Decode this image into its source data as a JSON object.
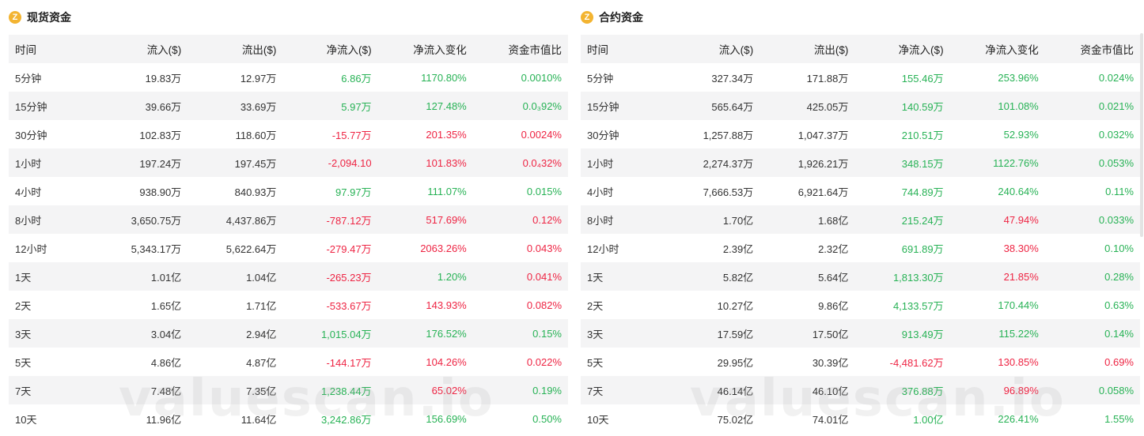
{
  "colors": {
    "positive": "#27b255",
    "negative": "#ee2443",
    "accent": "#f3b431"
  },
  "watermark": "valuescan.io",
  "spot": {
    "title": "现货资金",
    "icon": "coin-icon",
    "columns": [
      "时间",
      "流入($)",
      "流出($)",
      "净流入($)",
      "净流入变化",
      "资金市值比"
    ],
    "rows": [
      {
        "time": "5分钟",
        "inflow": "19.83万",
        "outflow": "12.97万",
        "net": "6.86万",
        "net_s": "pos",
        "change": "1170.80%",
        "change_s": "pos",
        "ratio": "0.0010%",
        "ratio_s": "pos"
      },
      {
        "time": "15分钟",
        "inflow": "39.66万",
        "outflow": "33.69万",
        "net": "5.97万",
        "net_s": "pos",
        "change": "127.48%",
        "change_s": "pos",
        "ratio": "0.0₃92%",
        "ratio_s": "pos"
      },
      {
        "time": "30分钟",
        "inflow": "102.83万",
        "outflow": "118.60万",
        "net": "-15.77万",
        "net_s": "neg",
        "change": "201.35%",
        "change_s": "neg",
        "ratio": "0.0024%",
        "ratio_s": "neg"
      },
      {
        "time": "1小时",
        "inflow": "197.24万",
        "outflow": "197.45万",
        "net": "-2,094.10",
        "net_s": "neg",
        "change": "101.83%",
        "change_s": "neg",
        "ratio": "0.0₄32%",
        "ratio_s": "neg"
      },
      {
        "time": "4小时",
        "inflow": "938.90万",
        "outflow": "840.93万",
        "net": "97.97万",
        "net_s": "pos",
        "change": "111.07%",
        "change_s": "pos",
        "ratio": "0.015%",
        "ratio_s": "pos"
      },
      {
        "time": "8小时",
        "inflow": "3,650.75万",
        "outflow": "4,437.86万",
        "net": "-787.12万",
        "net_s": "neg",
        "change": "517.69%",
        "change_s": "neg",
        "ratio": "0.12%",
        "ratio_s": "neg"
      },
      {
        "time": "12小时",
        "inflow": "5,343.17万",
        "outflow": "5,622.64万",
        "net": "-279.47万",
        "net_s": "neg",
        "change": "2063.26%",
        "change_s": "neg",
        "ratio": "0.043%",
        "ratio_s": "neg"
      },
      {
        "time": "1天",
        "inflow": "1.01亿",
        "outflow": "1.04亿",
        "net": "-265.23万",
        "net_s": "neg",
        "change": "1.20%",
        "change_s": "pos",
        "ratio": "0.041%",
        "ratio_s": "neg"
      },
      {
        "time": "2天",
        "inflow": "1.65亿",
        "outflow": "1.71亿",
        "net": "-533.67万",
        "net_s": "neg",
        "change": "143.93%",
        "change_s": "neg",
        "ratio": "0.082%",
        "ratio_s": "neg"
      },
      {
        "time": "3天",
        "inflow": "3.04亿",
        "outflow": "2.94亿",
        "net": "1,015.04万",
        "net_s": "pos",
        "change": "176.52%",
        "change_s": "pos",
        "ratio": "0.15%",
        "ratio_s": "pos"
      },
      {
        "time": "5天",
        "inflow": "4.86亿",
        "outflow": "4.87亿",
        "net": "-144.17万",
        "net_s": "neg",
        "change": "104.26%",
        "change_s": "neg",
        "ratio": "0.022%",
        "ratio_s": "neg"
      },
      {
        "time": "7天",
        "inflow": "7.48亿",
        "outflow": "7.35亿",
        "net": "1,238.44万",
        "net_s": "pos",
        "change": "65.02%",
        "change_s": "neg",
        "ratio": "0.19%",
        "ratio_s": "pos"
      },
      {
        "time": "10天",
        "inflow": "11.96亿",
        "outflow": "11.64亿",
        "net": "3,242.86万",
        "net_s": "pos",
        "change": "156.69%",
        "change_s": "pos",
        "ratio": "0.50%",
        "ratio_s": "pos"
      }
    ]
  },
  "futures": {
    "title": "合约资金",
    "icon": "coin-icon",
    "columns": [
      "时间",
      "流入($)",
      "流出($)",
      "净流入($)",
      "净流入变化",
      "资金市值比"
    ],
    "rows": [
      {
        "time": "5分钟",
        "inflow": "327.34万",
        "outflow": "171.88万",
        "net": "155.46万",
        "net_s": "pos",
        "change": "253.96%",
        "change_s": "pos",
        "ratio": "0.024%",
        "ratio_s": "pos"
      },
      {
        "time": "15分钟",
        "inflow": "565.64万",
        "outflow": "425.05万",
        "net": "140.59万",
        "net_s": "pos",
        "change": "101.08%",
        "change_s": "pos",
        "ratio": "0.021%",
        "ratio_s": "pos"
      },
      {
        "time": "30分钟",
        "inflow": "1,257.88万",
        "outflow": "1,047.37万",
        "net": "210.51万",
        "net_s": "pos",
        "change": "52.93%",
        "change_s": "pos",
        "ratio": "0.032%",
        "ratio_s": "pos"
      },
      {
        "time": "1小时",
        "inflow": "2,274.37万",
        "outflow": "1,926.21万",
        "net": "348.15万",
        "net_s": "pos",
        "change": "1122.76%",
        "change_s": "pos",
        "ratio": "0.053%",
        "ratio_s": "pos"
      },
      {
        "time": "4小时",
        "inflow": "7,666.53万",
        "outflow": "6,921.64万",
        "net": "744.89万",
        "net_s": "pos",
        "change": "240.64%",
        "change_s": "pos",
        "ratio": "0.11%",
        "ratio_s": "pos"
      },
      {
        "time": "8小时",
        "inflow": "1.70亿",
        "outflow": "1.68亿",
        "net": "215.24万",
        "net_s": "pos",
        "change": "47.94%",
        "change_s": "neg",
        "ratio": "0.033%",
        "ratio_s": "pos"
      },
      {
        "time": "12小时",
        "inflow": "2.39亿",
        "outflow": "2.32亿",
        "net": "691.89万",
        "net_s": "pos",
        "change": "38.30%",
        "change_s": "neg",
        "ratio": "0.10%",
        "ratio_s": "pos"
      },
      {
        "time": "1天",
        "inflow": "5.82亿",
        "outflow": "5.64亿",
        "net": "1,813.30万",
        "net_s": "pos",
        "change": "21.85%",
        "change_s": "neg",
        "ratio": "0.28%",
        "ratio_s": "pos"
      },
      {
        "time": "2天",
        "inflow": "10.27亿",
        "outflow": "9.86亿",
        "net": "4,133.57万",
        "net_s": "pos",
        "change": "170.44%",
        "change_s": "pos",
        "ratio": "0.63%",
        "ratio_s": "pos"
      },
      {
        "time": "3天",
        "inflow": "17.59亿",
        "outflow": "17.50亿",
        "net": "913.49万",
        "net_s": "pos",
        "change": "115.22%",
        "change_s": "pos",
        "ratio": "0.14%",
        "ratio_s": "pos"
      },
      {
        "time": "5天",
        "inflow": "29.95亿",
        "outflow": "30.39亿",
        "net": "-4,481.62万",
        "net_s": "neg",
        "change": "130.85%",
        "change_s": "neg",
        "ratio": "0.69%",
        "ratio_s": "neg"
      },
      {
        "time": "7天",
        "inflow": "46.14亿",
        "outflow": "46.10亿",
        "net": "376.88万",
        "net_s": "pos",
        "change": "96.89%",
        "change_s": "neg",
        "ratio": "0.058%",
        "ratio_s": "pos"
      },
      {
        "time": "10天",
        "inflow": "75.02亿",
        "outflow": "74.01亿",
        "net": "1.00亿",
        "net_s": "pos",
        "change": "226.41%",
        "change_s": "pos",
        "ratio": "1.55%",
        "ratio_s": "pos"
      }
    ]
  }
}
